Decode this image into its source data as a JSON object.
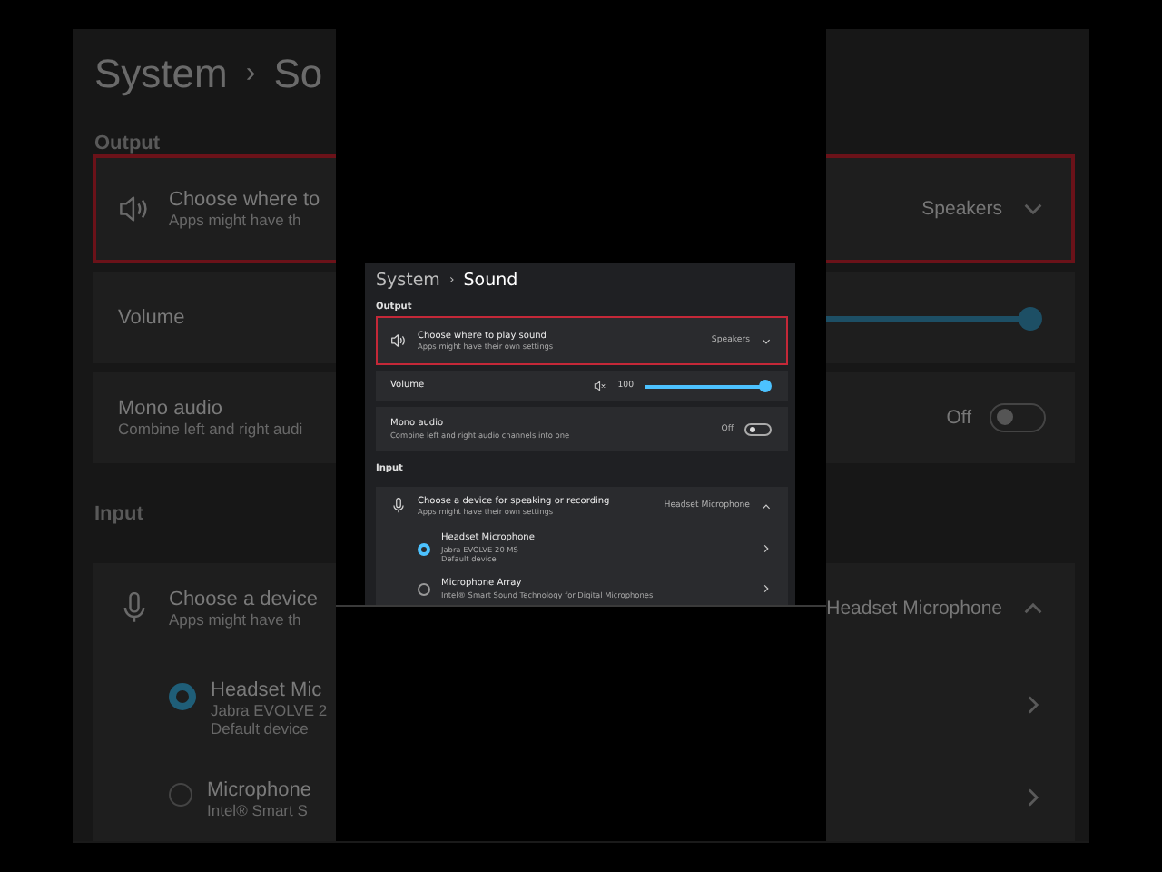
{
  "backdrop_left": {
    "title": "System",
    "separator": "›",
    "title_cut": "So",
    "output_heading": "Output",
    "output_card": {
      "title": "Choose where to",
      "subtitle": "Apps might have th",
      "highlighted": true
    },
    "volume_label": "Volume",
    "mono": {
      "title": "Mono audio",
      "subtitle": "Combine left and right audi"
    },
    "input_heading": "Input",
    "input_card": {
      "title": "Choose a device",
      "subtitle": "Apps might have th"
    },
    "devices": [
      {
        "name": "Headset Mic",
        "lines": [
          "Jabra EVOLVE 2",
          "Default device"
        ],
        "selected": true
      },
      {
        "name": "Microphone",
        "lines": [
          "Intel® Smart S"
        ],
        "selected": false
      }
    ]
  },
  "backdrop_right": {
    "output_value": "Speakers",
    "output_highlighted": true,
    "output_expanded": false,
    "volume": {
      "level": 1
    },
    "mono_state": "Off",
    "mono_on": false,
    "input_value": "Headset Microphone",
    "input_expanded": true
  },
  "window": {
    "breadcrumb": [
      {
        "label": "System",
        "current": false
      },
      {
        "label": "Sound",
        "current": true
      }
    ],
    "separator": "›"
  },
  "output": {
    "heading": "Output",
    "device_picker": {
      "title": "Choose where to play sound",
      "subtitle": "Apps might have their own settings",
      "value": "Speakers",
      "highlighted": true,
      "expanded": false
    },
    "volume": {
      "label": "Volume",
      "reading": "100",
      "level": 1
    },
    "mono": {
      "title": "Mono audio",
      "subtitle": "Combine left and right audio channels into one",
      "state_label": "Off",
      "on": false
    }
  },
  "input": {
    "heading": "Input",
    "device_picker": {
      "title": "Choose a device for speaking or recording",
      "subtitle": "Apps might have their own settings",
      "value": "Headset Microphone",
      "highlighted": false,
      "expanded": true
    },
    "devices": [
      {
        "name": "Headset Microphone",
        "lines": [
          "Jabra EVOLVE 20 MS",
          "Default device"
        ],
        "selected": true
      },
      {
        "name": "Microphone Array",
        "lines": [
          "Intel® Smart Sound Technology for Digital Microphones"
        ],
        "selected": false
      }
    ]
  }
}
